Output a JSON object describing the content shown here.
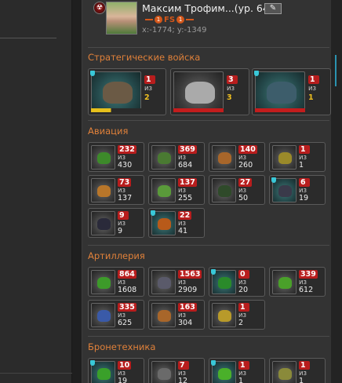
{
  "player": {
    "clan_icon": "clan-emblem-icon",
    "name": "Максим Трофим...(ур. 64)",
    "edit_icon": "pencil-icon",
    "rank_left": "1",
    "rank_tag": "FS",
    "rank_right": "1",
    "coords": "x:-1774; y:-1349"
  },
  "sections": [
    {
      "title": "Стратегические войска",
      "units": [
        {
          "icon": "siege-tank-icon",
          "have": "1",
          "of": "из",
          "total": "2",
          "bar_color": "#e6c01c",
          "teal": true
        },
        {
          "icon": "battleship-icon",
          "have": "3",
          "of": "из",
          "total": "3",
          "bar_color": "#c31d1d",
          "teal": false
        },
        {
          "icon": "reactor-fortress-icon",
          "have": "1",
          "of": "из",
          "total": "1",
          "bar_color": "#c31d1d",
          "teal": true
        }
      ]
    },
    {
      "title": "Авиация",
      "units": [
        {
          "icon": "helicopter-green-icon",
          "have": "232",
          "of": "из",
          "total": "430",
          "teal": false
        },
        {
          "icon": "gunship-green-icon",
          "have": "369",
          "of": "из",
          "total": "684",
          "teal": false
        },
        {
          "icon": "jet-orange-icon",
          "have": "140",
          "of": "из",
          "total": "260",
          "teal": false
        },
        {
          "icon": "bomber-yellow-icon",
          "have": "1",
          "of": "из",
          "total": "1",
          "teal": false
        },
        {
          "icon": "attack-jet-orange-icon",
          "have": "73",
          "of": "из",
          "total": "137",
          "teal": false
        },
        {
          "icon": "drone-green-icon",
          "have": "137",
          "of": "из",
          "total": "255",
          "teal": false
        },
        {
          "icon": "mech-flyer-icon",
          "have": "27",
          "of": "из",
          "total": "50",
          "teal": false
        },
        {
          "icon": "stealth-bomber-icon",
          "have": "6",
          "of": "из",
          "total": "19",
          "teal": true
        },
        {
          "icon": "dark-fighter-icon",
          "have": "9",
          "of": "из",
          "total": "9",
          "teal": false
        },
        {
          "icon": "fire-drone-icon",
          "have": "22",
          "of": "из",
          "total": "41",
          "teal": true
        }
      ]
    },
    {
      "title": "Артиллерия",
      "units": [
        {
          "icon": "artillery-green-icon",
          "have": "864",
          "of": "из",
          "total": "1608",
          "teal": false
        },
        {
          "icon": "rocket-launcher-icon",
          "have": "1563",
          "of": "из",
          "total": "2909",
          "teal": false
        },
        {
          "icon": "heavy-artillery-icon",
          "have": "0",
          "of": "из",
          "total": "20",
          "teal": true
        },
        {
          "icon": "mortar-green-icon",
          "have": "339",
          "of": "из",
          "total": "612",
          "teal": false
        },
        {
          "icon": "missile-blue-icon",
          "have": "335",
          "of": "из",
          "total": "625",
          "teal": false
        },
        {
          "icon": "howitzer-orange-icon",
          "have": "163",
          "of": "из",
          "total": "304",
          "teal": false
        },
        {
          "icon": "cannon-gold-icon",
          "have": "1",
          "of": "из",
          "total": "2",
          "teal": false
        }
      ]
    },
    {
      "title": "Бронетехника",
      "units": [
        {
          "icon": "buggy-green-icon",
          "have": "10",
          "of": "из",
          "total": "19",
          "teal": true
        },
        {
          "icon": "apc-icon",
          "have": "7",
          "of": "из",
          "total": "12",
          "teal": false
        },
        {
          "icon": "hover-tank-icon",
          "have": "1",
          "of": "из",
          "total": "1",
          "teal": true
        },
        {
          "icon": "scorpion-tank-icon",
          "have": "1",
          "of": "из",
          "total": "1",
          "teal": false
        }
      ]
    }
  ],
  "colors": {
    "section_title": "#e0813a",
    "count_badge": "#b81d1d",
    "shield": "#39c8d8"
  }
}
